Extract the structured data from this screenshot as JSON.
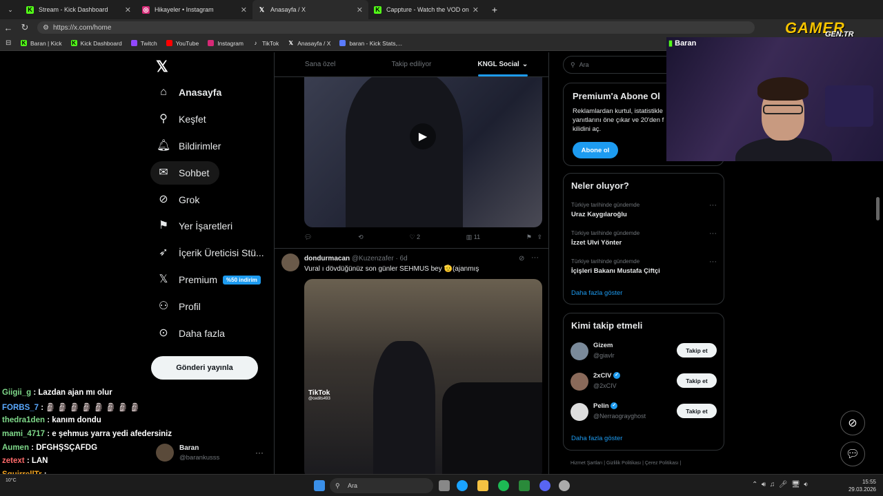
{
  "browser": {
    "tabs": [
      {
        "title": "Stream - Kick Dashboard",
        "icon": "kick-icon",
        "active": false
      },
      {
        "title": "Hikayeler • Instagram",
        "icon": "instagram-icon",
        "active": false
      },
      {
        "title": "Anasayfa / X",
        "icon": "x-icon",
        "active": true
      },
      {
        "title": "Cappture - Watch the VOD on Kick",
        "icon": "kick-icon",
        "active": false
      }
    ],
    "url": "https://x.com/home",
    "bookmarks": [
      "Baran | Kick",
      "Kick Dashboard",
      "Twitch",
      "YouTube",
      "Instagram",
      "TikTok",
      "Anasayfa / X",
      "baran - Kick Stats,..."
    ]
  },
  "sidebar": {
    "items": [
      {
        "label": "Anasayfa",
        "icon": "home-icon"
      },
      {
        "label": "Keşfet",
        "icon": "search-icon"
      },
      {
        "label": "Bildirimler",
        "icon": "bell-icon"
      },
      {
        "label": "Sohbet",
        "icon": "mail-icon"
      },
      {
        "label": "Grok",
        "icon": "grok-icon"
      },
      {
        "label": "Yer İşaretleri",
        "icon": "bookmark-icon"
      },
      {
        "label": "İçerik Üreticisi Stü...",
        "icon": "rocket-icon"
      },
      {
        "label": "Premium",
        "icon": "x-icon",
        "badge": "%50 indirim"
      },
      {
        "label": "Profil",
        "icon": "person-icon"
      },
      {
        "label": "Daha fazla",
        "icon": "more-circle-icon"
      }
    ],
    "post_button": "Gönderi yayınla",
    "account": {
      "name": "Baran",
      "handle": "@barankusss"
    }
  },
  "feed": {
    "tabs": [
      "Sana özel",
      "Takip ediliyor",
      "KNGL Social"
    ],
    "tweet1_actions": {
      "reply": "",
      "repost": "",
      "like": "2",
      "views": "11"
    },
    "tweet2": {
      "name": "dondurmacan",
      "handle": "@Kuzenzafer",
      "time": "· 6d",
      "text": "Vural ı dövdüğünüz son günler SEHMUS bey 🫡(ajanmış",
      "watermark": "TikTok",
      "watermark_handle": "@cedits493"
    }
  },
  "right": {
    "search_placeholder": "Ara",
    "premium": {
      "title": "Premium'a Abone Ol",
      "text": "Reklamlardan kurtul, istatistikle yanıtlarını öne çıkar ve 20'den f kilidini aç.",
      "button": "Abone ol"
    },
    "trends": {
      "title": "Neler oluyor?",
      "items": [
        {
          "context": "Türkiye tarihinde gündemde",
          "name": "Uraz Kaygılaroğlu"
        },
        {
          "context": "Türkiye tarihinde gündemde",
          "name": "İzzet Ulvi Yönter"
        },
        {
          "context": "Türkiye tarihinde gündemde",
          "name": "İçişleri Bakanı Mustafa Çiftçi"
        }
      ],
      "more": "Daha fazla göster"
    },
    "who": {
      "title": "Kimi takip etmeli",
      "items": [
        {
          "name": "Gizem",
          "handle": "@giavlr",
          "verified": false
        },
        {
          "name": "2xCIV",
          "handle": "@2xCIV",
          "verified": true
        },
        {
          "name": "Pelin",
          "handle": "@Nerraograyghost",
          "verified": true
        }
      ],
      "follow": "Takip et",
      "more": "Daha fazla göster"
    },
    "footer": "Hizmet Şartları  |  Gizlilik Politikası  |  Çerez Politikası  |"
  },
  "overlay": {
    "cam_name": "Baran",
    "logo_top": "GAMER",
    "logo_bottom": "GEN.TR",
    "chat": [
      {
        "user": "Giigii_g",
        "msg": ": Lazdan ajan mı olur",
        "color": "#7fd98a"
      },
      {
        "user": "FORBS_7",
        "msg": ": 🗿 🗿 🗿 🗿 🗿 🗿 🗿 🗿",
        "color": "#5aa9ff"
      },
      {
        "user": "thedra1den",
        "msg": ": kanım dondu",
        "color": "#7fd98a"
      },
      {
        "user": "mami_4717",
        "msg": ": e şehmus yarra yedi afedersiniz",
        "color": "#7fd98a"
      },
      {
        "user": "Aumen",
        "msg": ": DFGHŞSÇAFDG",
        "color": "#7fd98a"
      },
      {
        "user": "zetext",
        "msg": ": LAN",
        "color": "#ff6a6a"
      },
      {
        "user": "SquirrellTr",
        "msg": ":",
        "color": "#f5a623"
      }
    ]
  },
  "taskbar": {
    "search": "Ara",
    "time": "15:55",
    "date": "29.03.2026",
    "weather": "10°C"
  }
}
